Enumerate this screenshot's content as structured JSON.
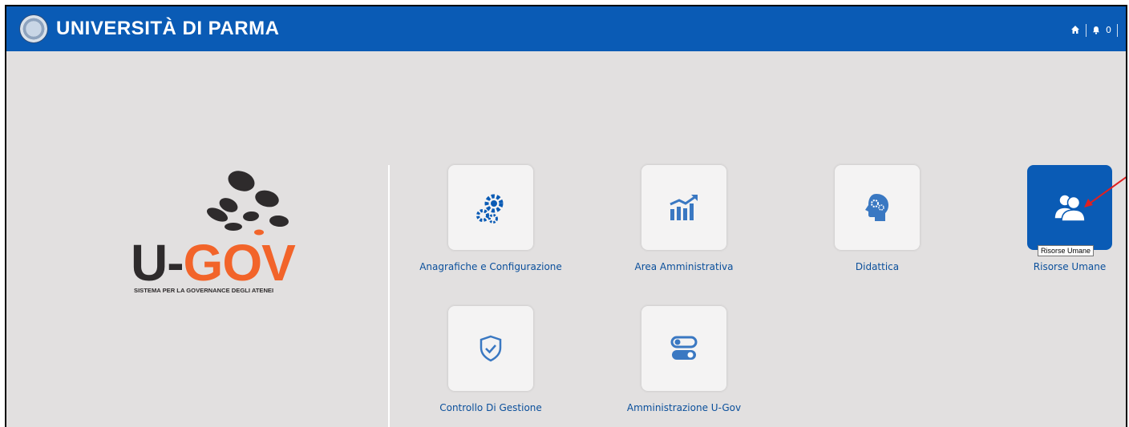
{
  "header": {
    "brand": "UNIVERSITÀ DI PARMA",
    "notification_count": "0",
    "background_color": "#0a5bb5"
  },
  "logo": {
    "u": "U-",
    "gov": "GOV",
    "subtitle": "SISTEMA PER LA GOVERNANCE DEGLI ATENEI",
    "accent_color": "#f2642a"
  },
  "tiles": [
    {
      "label": "Anagrafiche e Configurazione",
      "icon": "gears-icon"
    },
    {
      "label": "Area Amministrativa",
      "icon": "chart-growth-icon"
    },
    {
      "label": "Didattica",
      "icon": "head-gears-icon"
    },
    {
      "label": "Risorse Umane",
      "icon": "users-icon",
      "active": true
    },
    {
      "label": "Controllo Di Gestione",
      "icon": "shield-check-icon"
    },
    {
      "label": "Amministrazione U-Gov",
      "icon": "toggles-icon"
    }
  ],
  "tooltip": "Risorse Umane"
}
